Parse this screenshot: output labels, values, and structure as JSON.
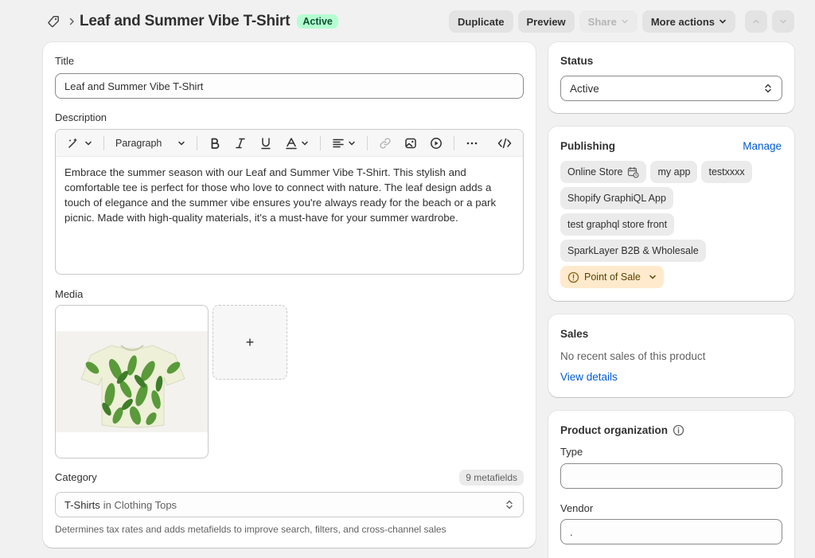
{
  "header": {
    "title": "Leaf and Summer Vibe T-Shirt",
    "status_badge": "Active",
    "actions": {
      "duplicate": "Duplicate",
      "preview": "Preview",
      "share": "Share",
      "more_actions": "More actions"
    }
  },
  "main": {
    "title_label": "Title",
    "title_value": "Leaf and Summer Vibe T-Shirt",
    "description_label": "Description",
    "toolbar": {
      "paragraph": "Paragraph"
    },
    "description_text": "Embrace the summer season with our Leaf and Summer Vibe T-Shirt. This stylish and comfortable tee is perfect for those who love to connect with nature. The leaf design adds a touch of elegance and the summer vibe ensures you're always ready for the beach or a park picnic. Made with high-quality materials, it's a must-have for your summer wardrobe.",
    "media_label": "Media",
    "media_add": "+",
    "category_label": "Category",
    "metafields_badge": "9 metafields",
    "category_value": "T-Shirts",
    "category_in": "in Clothing Tops",
    "category_help": "Determines tax rates and adds metafields to improve search, filters, and cross-channel sales"
  },
  "status_card": {
    "title": "Status",
    "value": "Active"
  },
  "publishing": {
    "title": "Publishing",
    "manage": "Manage",
    "channels": [
      "Online Store",
      "my app",
      "testxxxx",
      "Shopify GraphiQL App",
      "test graphql store front",
      "SparkLayer B2B & Wholesale"
    ],
    "warning_channel": "Point of Sale"
  },
  "sales": {
    "title": "Sales",
    "text": "No recent sales of this product",
    "link": "View details"
  },
  "organization": {
    "title": "Product organization",
    "type_label": "Type",
    "type_value": "",
    "vendor_label": "Vendor",
    "vendor_value": "."
  }
}
